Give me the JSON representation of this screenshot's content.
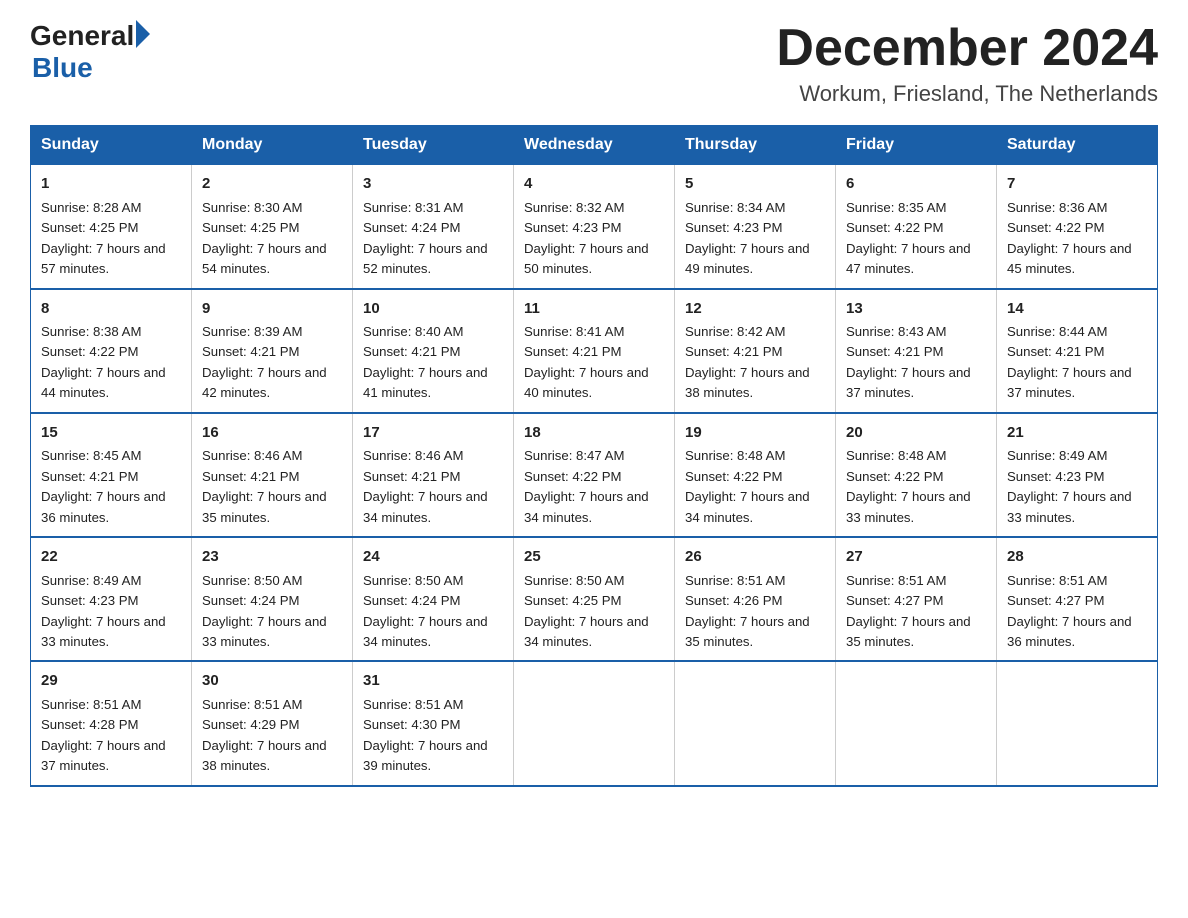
{
  "header": {
    "logo_general": "General",
    "logo_blue": "Blue",
    "month_title": "December 2024",
    "location": "Workum, Friesland, The Netherlands"
  },
  "days_of_week": [
    "Sunday",
    "Monday",
    "Tuesday",
    "Wednesday",
    "Thursday",
    "Friday",
    "Saturday"
  ],
  "weeks": [
    [
      {
        "day": "1",
        "sunrise": "8:28 AM",
        "sunset": "4:25 PM",
        "daylight": "7 hours and 57 minutes."
      },
      {
        "day": "2",
        "sunrise": "8:30 AM",
        "sunset": "4:25 PM",
        "daylight": "7 hours and 54 minutes."
      },
      {
        "day": "3",
        "sunrise": "8:31 AM",
        "sunset": "4:24 PM",
        "daylight": "7 hours and 52 minutes."
      },
      {
        "day": "4",
        "sunrise": "8:32 AM",
        "sunset": "4:23 PM",
        "daylight": "7 hours and 50 minutes."
      },
      {
        "day": "5",
        "sunrise": "8:34 AM",
        "sunset": "4:23 PM",
        "daylight": "7 hours and 49 minutes."
      },
      {
        "day": "6",
        "sunrise": "8:35 AM",
        "sunset": "4:22 PM",
        "daylight": "7 hours and 47 minutes."
      },
      {
        "day": "7",
        "sunrise": "8:36 AM",
        "sunset": "4:22 PM",
        "daylight": "7 hours and 45 minutes."
      }
    ],
    [
      {
        "day": "8",
        "sunrise": "8:38 AM",
        "sunset": "4:22 PM",
        "daylight": "7 hours and 44 minutes."
      },
      {
        "day": "9",
        "sunrise": "8:39 AM",
        "sunset": "4:21 PM",
        "daylight": "7 hours and 42 minutes."
      },
      {
        "day": "10",
        "sunrise": "8:40 AM",
        "sunset": "4:21 PM",
        "daylight": "7 hours and 41 minutes."
      },
      {
        "day": "11",
        "sunrise": "8:41 AM",
        "sunset": "4:21 PM",
        "daylight": "7 hours and 40 minutes."
      },
      {
        "day": "12",
        "sunrise": "8:42 AM",
        "sunset": "4:21 PM",
        "daylight": "7 hours and 38 minutes."
      },
      {
        "day": "13",
        "sunrise": "8:43 AM",
        "sunset": "4:21 PM",
        "daylight": "7 hours and 37 minutes."
      },
      {
        "day": "14",
        "sunrise": "8:44 AM",
        "sunset": "4:21 PM",
        "daylight": "7 hours and 37 minutes."
      }
    ],
    [
      {
        "day": "15",
        "sunrise": "8:45 AM",
        "sunset": "4:21 PM",
        "daylight": "7 hours and 36 minutes."
      },
      {
        "day": "16",
        "sunrise": "8:46 AM",
        "sunset": "4:21 PM",
        "daylight": "7 hours and 35 minutes."
      },
      {
        "day": "17",
        "sunrise": "8:46 AM",
        "sunset": "4:21 PM",
        "daylight": "7 hours and 34 minutes."
      },
      {
        "day": "18",
        "sunrise": "8:47 AM",
        "sunset": "4:22 PM",
        "daylight": "7 hours and 34 minutes."
      },
      {
        "day": "19",
        "sunrise": "8:48 AM",
        "sunset": "4:22 PM",
        "daylight": "7 hours and 34 minutes."
      },
      {
        "day": "20",
        "sunrise": "8:48 AM",
        "sunset": "4:22 PM",
        "daylight": "7 hours and 33 minutes."
      },
      {
        "day": "21",
        "sunrise": "8:49 AM",
        "sunset": "4:23 PM",
        "daylight": "7 hours and 33 minutes."
      }
    ],
    [
      {
        "day": "22",
        "sunrise": "8:49 AM",
        "sunset": "4:23 PM",
        "daylight": "7 hours and 33 minutes."
      },
      {
        "day": "23",
        "sunrise": "8:50 AM",
        "sunset": "4:24 PM",
        "daylight": "7 hours and 33 minutes."
      },
      {
        "day": "24",
        "sunrise": "8:50 AM",
        "sunset": "4:24 PM",
        "daylight": "7 hours and 34 minutes."
      },
      {
        "day": "25",
        "sunrise": "8:50 AM",
        "sunset": "4:25 PM",
        "daylight": "7 hours and 34 minutes."
      },
      {
        "day": "26",
        "sunrise": "8:51 AM",
        "sunset": "4:26 PM",
        "daylight": "7 hours and 35 minutes."
      },
      {
        "day": "27",
        "sunrise": "8:51 AM",
        "sunset": "4:27 PM",
        "daylight": "7 hours and 35 minutes."
      },
      {
        "day": "28",
        "sunrise": "8:51 AM",
        "sunset": "4:27 PM",
        "daylight": "7 hours and 36 minutes."
      }
    ],
    [
      {
        "day": "29",
        "sunrise": "8:51 AM",
        "sunset": "4:28 PM",
        "daylight": "7 hours and 37 minutes."
      },
      {
        "day": "30",
        "sunrise": "8:51 AM",
        "sunset": "4:29 PM",
        "daylight": "7 hours and 38 minutes."
      },
      {
        "day": "31",
        "sunrise": "8:51 AM",
        "sunset": "4:30 PM",
        "daylight": "7 hours and 39 minutes."
      },
      null,
      null,
      null,
      null
    ]
  ]
}
